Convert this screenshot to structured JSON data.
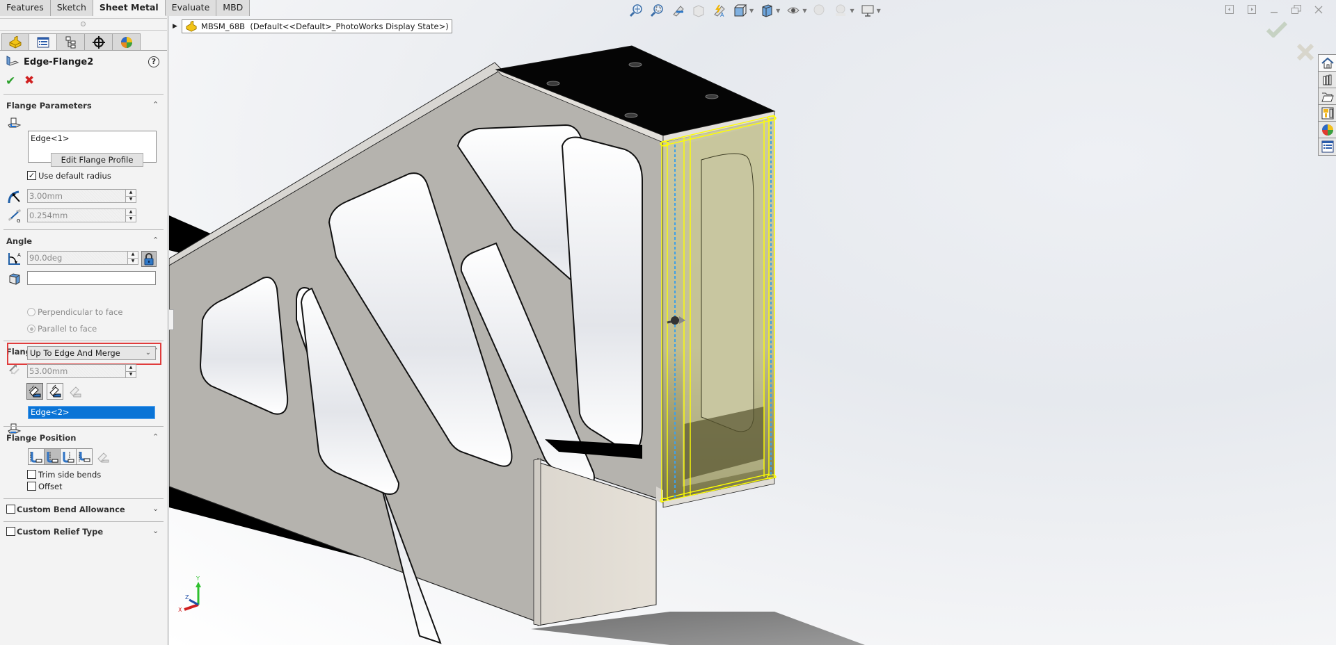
{
  "command_manager": {
    "tabs": [
      {
        "label": "Features",
        "active": false
      },
      {
        "label": "Sketch",
        "active": false
      },
      {
        "label": "Sheet Metal",
        "active": true
      },
      {
        "label": "Evaluate",
        "active": false
      },
      {
        "label": "MBD",
        "active": false
      }
    ]
  },
  "manager_tabs": [
    {
      "icon": "feature-manager-icon"
    },
    {
      "icon": "property-manager-icon",
      "active": true
    },
    {
      "icon": "configuration-manager-icon"
    },
    {
      "icon": "dimxpert-manager-icon"
    },
    {
      "icon": "display-manager-icon"
    }
  ],
  "property_manager": {
    "title": "Edge-Flange2",
    "help_label": "?",
    "ok_label": "✔",
    "cancel_label": "✖",
    "flange_parameters": {
      "title": "Flange Parameters",
      "edge_selection": "Edge<1>",
      "edit_profile_label": "Edit Flange Profile",
      "use_default_radius_label": "Use default radius",
      "use_default_radius": true,
      "bend_radius": "3.00mm",
      "gap_distance": "0.254mm"
    },
    "angle": {
      "title": "Angle",
      "flange_angle": "90.0deg",
      "reference_face": "",
      "perpendicular_label": "Perpendicular to face",
      "parallel_label": "Parallel to face",
      "selected_option": "parallel"
    },
    "flange_length": {
      "title": "Flange Length",
      "end_condition": "Up To Edge And Merge",
      "length": "53.00mm",
      "up_to_selection": "Edge<2>"
    },
    "flange_position": {
      "title": "Flange Position",
      "selected_index": 1,
      "trim_side_bends_label": "Trim side bends",
      "trim_side_bends": false,
      "offset_label": "Offset",
      "offset": false
    },
    "custom_bend_allowance": {
      "label": "Custom Bend Allowance",
      "checked": false
    },
    "custom_relief_type": {
      "label": "Custom Relief Type",
      "checked": false
    }
  },
  "viewport": {
    "breadcrumb": "MBSM_68B  (Default<<Default>_PhotoWorks Display State>)",
    "heads_up_toolbar": [
      "zoom-to-fit-icon",
      "zoom-to-area-icon",
      "previous-view-icon",
      "section-view-icon",
      "dynamic-annotation-views-icon",
      "view-orientation-icon",
      "display-style-icon",
      "hide-show-items-icon",
      "edit-appearance-icon",
      "apply-scene-icon",
      "view-settings-icon"
    ],
    "triad_labels": {
      "x": "X",
      "y": "Y",
      "z": "Z"
    },
    "highlight_color": "#ffff00",
    "preview_color": "#c8c59a"
  },
  "task_pane": [
    "solidworks-resources-icon",
    "design-library-icon",
    "file-explorer-icon",
    "view-palette-icon",
    "appearances-icon",
    "custom-properties-icon"
  ]
}
